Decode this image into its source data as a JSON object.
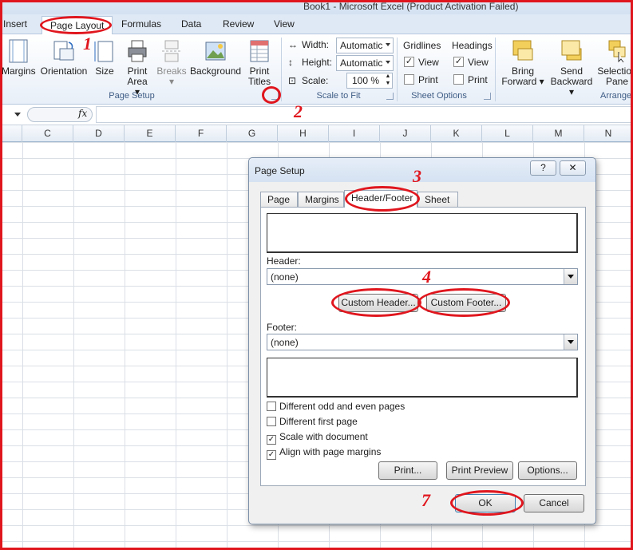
{
  "window": {
    "title": "Book1 - Microsoft Excel (Product Activation Failed)"
  },
  "ribbon_tabs": [
    "Insert",
    "Page Layout",
    "Formulas",
    "Data",
    "Review",
    "View"
  ],
  "page_setup_group": {
    "label": "Page Setup",
    "buttons": [
      "Margins",
      "Orientation",
      "Size",
      "Print",
      "Area",
      "Breaks",
      "Background",
      "Print",
      "Titles"
    ]
  },
  "scale_to_fit": {
    "label": "Scale to Fit",
    "width_label": "Width:",
    "width_value": "Automatic",
    "height_label": "Height:",
    "height_value": "Automatic",
    "scale_label": "Scale:",
    "scale_value": "100 %"
  },
  "sheet_options": {
    "label": "Sheet Options",
    "gridlines": "Gridlines",
    "headings": "Headings",
    "view": "View",
    "print": "Print"
  },
  "arrange": {
    "label": "Arrange",
    "bring_forward": [
      "Bring",
      "Forward"
    ],
    "send_backward": [
      "Send",
      "Backward"
    ],
    "selection_pane": [
      "Selection",
      "Pane"
    ]
  },
  "formula_bar": {
    "fx": "fx"
  },
  "columns": [
    "C",
    "D",
    "E",
    "F",
    "G",
    "H",
    "I",
    "J",
    "K",
    "L",
    "M",
    "N"
  ],
  "dialog": {
    "title": "Page Setup",
    "help": "?",
    "close": "✕",
    "tabs": [
      "Page",
      "Margins",
      "Header/Footer",
      "Sheet"
    ],
    "header_label": "Header:",
    "header_value": "(none)",
    "custom_header": "Custom Header...",
    "custom_footer": "Custom Footer...",
    "footer_label": "Footer:",
    "footer_value": "(none)",
    "options": [
      {
        "label": "Different odd and even pages",
        "checked": false
      },
      {
        "label": "Different first page",
        "checked": false
      },
      {
        "label": "Scale with document",
        "checked": true
      },
      {
        "label": "Align with page margins",
        "checked": true
      }
    ],
    "print_btn": "Print...",
    "preview_btn": "Print Preview",
    "options_btn": "Options...",
    "ok": "OK",
    "cancel": "Cancel"
  },
  "annotations": [
    "1",
    "2",
    "3",
    "4",
    "7"
  ],
  "colors": {
    "annotation": "#e0161e",
    "ribbon_bg": "#dfe9f5",
    "group_label": "#3e5d85"
  }
}
